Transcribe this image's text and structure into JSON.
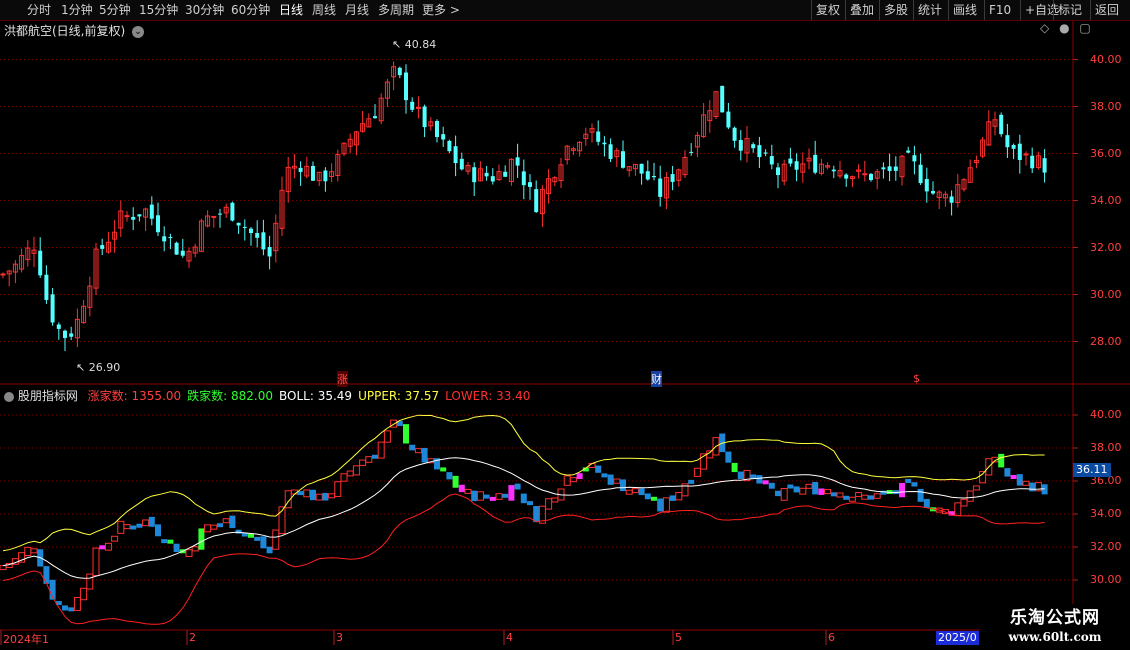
{
  "toolbar": {
    "periods": [
      "分时",
      "1分钟",
      "5分钟",
      "15分钟",
      "30分钟",
      "60分钟",
      "日线",
      "周线",
      "月线",
      "多周期",
      "更多 >"
    ],
    "active": "日线",
    "buttons": [
      "复权",
      "叠加",
      "多股",
      "统计",
      "画线",
      "F10",
      "+自选",
      "返回"
    ],
    "tool_extra": "标记"
  },
  "upper": {
    "title": "洪都航空(日线,前复权)",
    "high_label": "40.84",
    "low_label": "26.90",
    "axis_ticks": [
      "40.00",
      "38.00",
      "36.00",
      "34.00",
      "32.00",
      "30.00",
      "28.00"
    ],
    "markers": [
      "涨",
      "财",
      "$"
    ]
  },
  "lower": {
    "title": "股朋指标网",
    "items": [
      {
        "label": "涨家数: 1355.00",
        "color": "#ff4040"
      },
      {
        "label": "跌家数: 882.00",
        "color": "#30ff30"
      },
      {
        "label": "BOLL: 35.49",
        "color": "#ffffff"
      },
      {
        "label": "UPPER: 37.57",
        "color": "#ffff40"
      },
      {
        "label": "LOWER: 33.40",
        "color": "#ff3030"
      }
    ],
    "axis_ticks": [
      "40.00",
      "38.00",
      "36.00",
      "34.00",
      "32.00",
      "30.00"
    ],
    "price_tag": "36.11"
  },
  "dates": {
    "labels": [
      "2024年1",
      "2",
      "3",
      "4",
      "5",
      "6"
    ],
    "current": "2025/0"
  },
  "watermark": {
    "line1": "乐淘公式网",
    "line2": "www.60lt.com"
  },
  "colors": {
    "up": "#ff3030",
    "down": "#54ffff",
    "panel_border": "#8b0000",
    "boll": "#ffffff",
    "upper": "#ffff40",
    "lower": "#ff2020"
  }
}
